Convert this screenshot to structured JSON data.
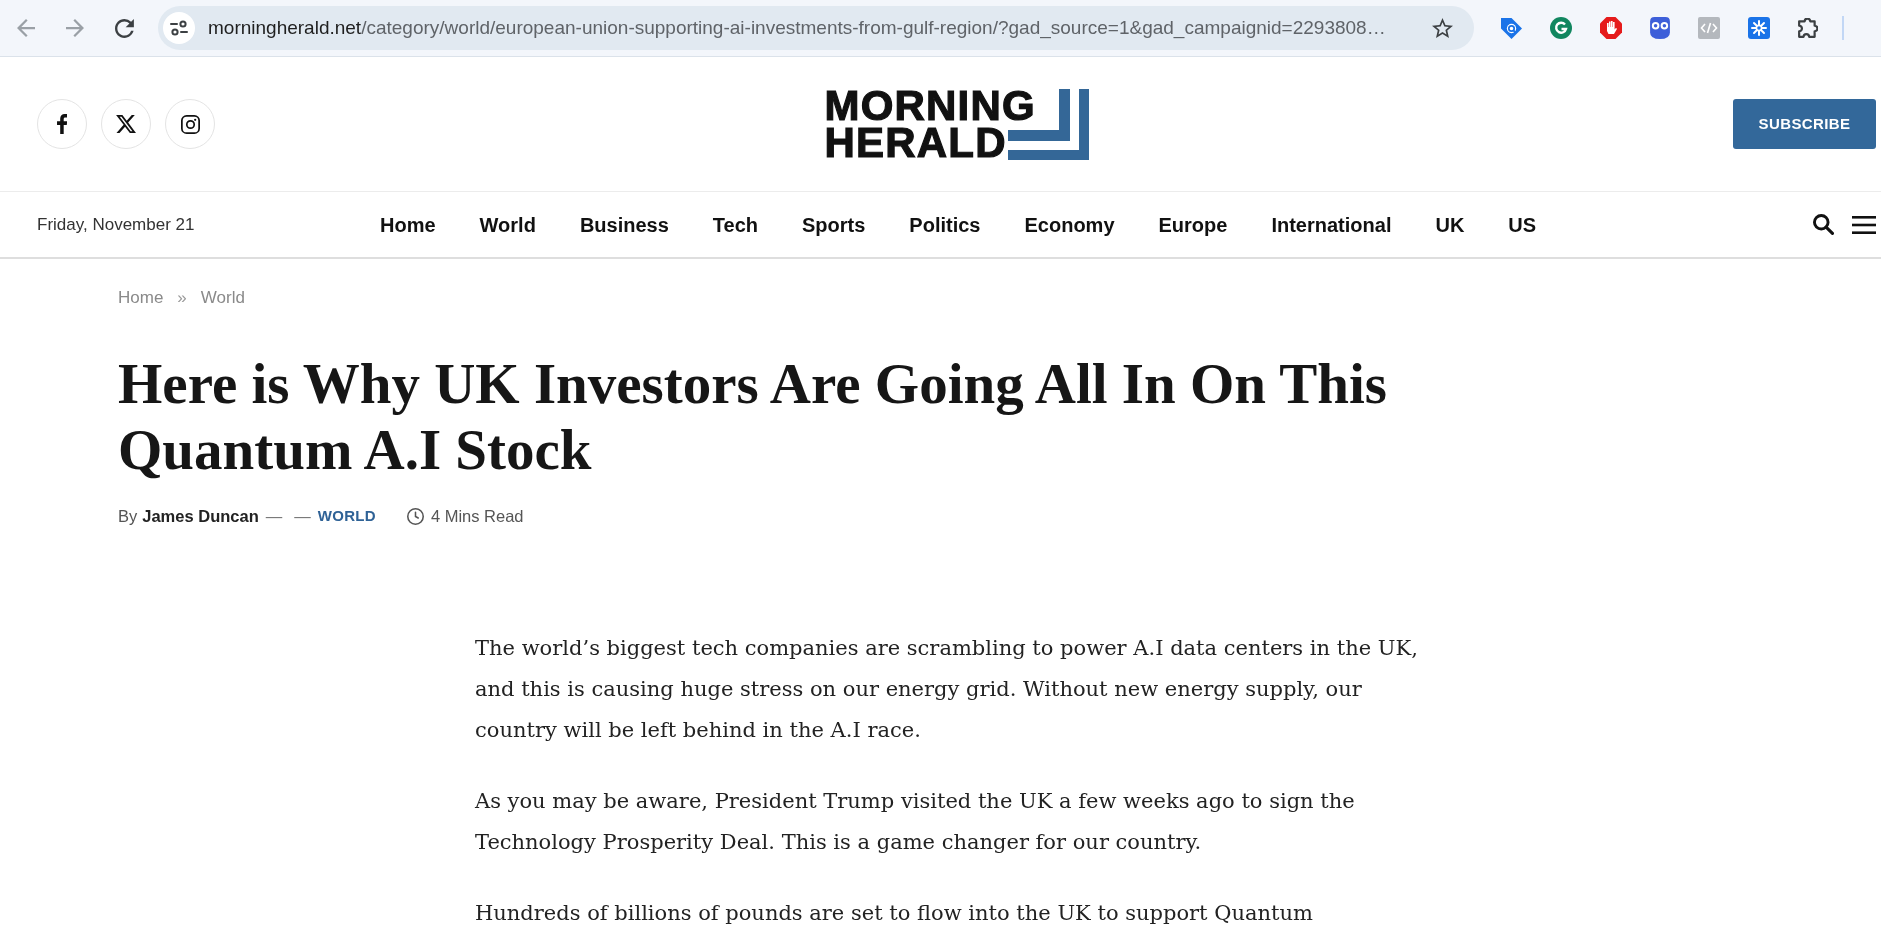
{
  "browser": {
    "back": {
      "disabled": true
    },
    "forward": {
      "disabled": true
    },
    "url": {
      "host": "morningherald.net",
      "path": "/category/world/european-union-supporting-ai-investments-from-gulf-region/?gad_source=1&gad_campaignid=2293808…"
    }
  },
  "header": {
    "logo": [
      "MORNING",
      "HERALD"
    ],
    "subscribe": "SUBSCRIBE"
  },
  "nav": {
    "date": "Friday, November 21",
    "items": [
      "Home",
      "World",
      "Business",
      "Tech",
      "Sports",
      "Politics",
      "Economy",
      "Europe",
      "International",
      "UK",
      "US"
    ]
  },
  "breadcrumb": {
    "items": [
      "Home",
      "World"
    ],
    "separator": "»"
  },
  "article": {
    "title": "Here is Why UK Investors Are Going All In On This Quantum A.I Stock",
    "byline": {
      "prefix": "By",
      "author": "James Duncan",
      "separators": [
        "—",
        "—"
      ],
      "category": "WORLD",
      "read_time": "4 Mins Read"
    },
    "paragraphs": [
      "The world’s biggest tech companies are scrambling to power A.I data centers in the UK, and this is causing huge stress on our energy grid. Without new energy supply, our country will be left behind in the A.I race.",
      "As you may be aware, President Trump visited the UK a few weeks ago to sign the Technology Prosperity Deal. This is a game changer for our country.",
      "Hundreds of billions of pounds are set to flow into the UK to support Quantum"
    ]
  }
}
